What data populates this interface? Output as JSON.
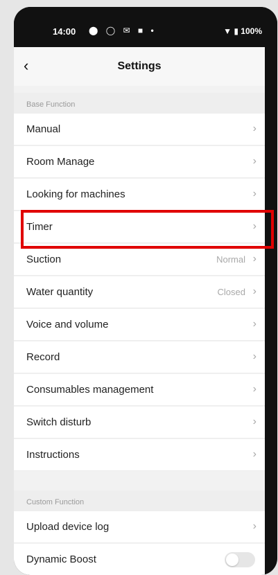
{
  "status": {
    "time": "14:00",
    "battery": "100%"
  },
  "header": {
    "title": "Settings"
  },
  "sections": {
    "base": "Base Function",
    "custom": "Custom Function"
  },
  "base_items": [
    {
      "label": "Manual"
    },
    {
      "label": "Room Manage"
    },
    {
      "label": "Looking for machines"
    },
    {
      "label": "Timer"
    },
    {
      "label": "Suction",
      "value": "Normal"
    },
    {
      "label": "Water quantity",
      "value": "Closed"
    },
    {
      "label": "Voice and volume"
    },
    {
      "label": "Record"
    },
    {
      "label": "Consumables management"
    },
    {
      "label": "Switch disturb"
    },
    {
      "label": "Instructions"
    }
  ],
  "custom_items": [
    {
      "label": "Upload device log"
    },
    {
      "label": "Dynamic Boost",
      "toggle": false
    }
  ],
  "highlight_color": "#e00000"
}
